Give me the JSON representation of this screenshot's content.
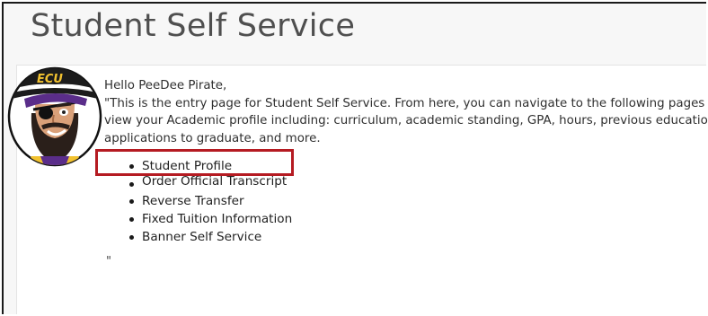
{
  "page": {
    "title": "Student Self Service"
  },
  "welcome": {
    "greeting": "Hello PeeDee Pirate,",
    "line1": "\"This is the entry page for Student Self Service. From here, you can navigate to the following pages usin",
    "line2": "view your Academic profile including: curriculum, academic standing, GPA, hours, previous education, t",
    "line3": "applications to graduate, and more.",
    "closing": "\""
  },
  "avatar": {
    "icon": "pirate-mascot-icon",
    "hat_text": "ECU",
    "colors": {
      "hat": "#1c1c1c",
      "hat_text": "#f2c230",
      "bandana": "#5a2d8a",
      "skin": "#d9a079",
      "beard": "#2a1f1a"
    }
  },
  "nav": {
    "items": [
      {
        "label": "Student Profile"
      },
      {
        "label": "Order Official Transcript"
      },
      {
        "label": "Reverse Transfer"
      },
      {
        "label": "Fixed Tuition Information"
      },
      {
        "label": "Banner Self Service"
      }
    ]
  },
  "highlight": {
    "color": "#b51b22"
  }
}
